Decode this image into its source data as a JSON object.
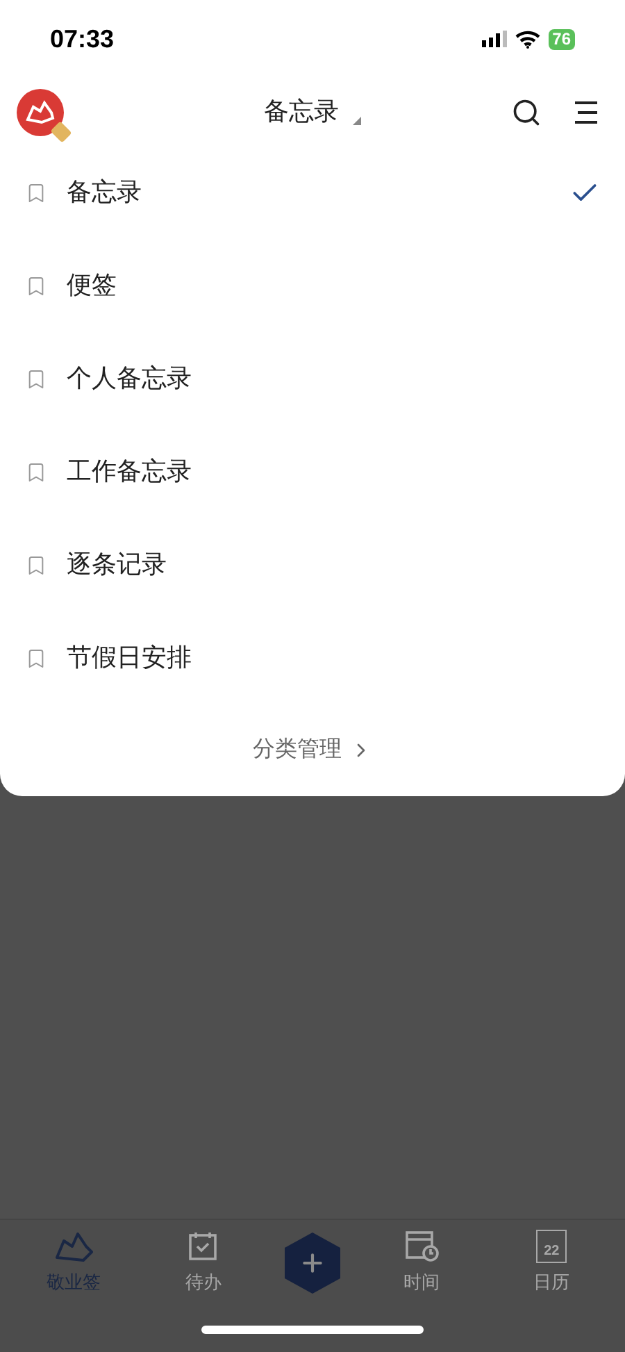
{
  "status_bar": {
    "time": "07:33",
    "battery": "76"
  },
  "header": {
    "title": "备忘录"
  },
  "categories": [
    {
      "label": "备忘录",
      "selected": true
    },
    {
      "label": "便签",
      "selected": false
    },
    {
      "label": "个人备忘录",
      "selected": false
    },
    {
      "label": "工作备忘录",
      "selected": false
    },
    {
      "label": "逐条记录",
      "selected": false
    },
    {
      "label": "节假日安排",
      "selected": false
    }
  ],
  "manage_link": "分类管理",
  "tab_bar": [
    {
      "kind": "notes",
      "label": "敬业签",
      "selected": true
    },
    {
      "kind": "todo",
      "label": "待办",
      "selected": false
    },
    {
      "kind": "add"
    },
    {
      "kind": "time",
      "label": "时间",
      "selected": false
    },
    {
      "kind": "calendar",
      "label": "日历",
      "selected": false,
      "day": "22"
    }
  ]
}
